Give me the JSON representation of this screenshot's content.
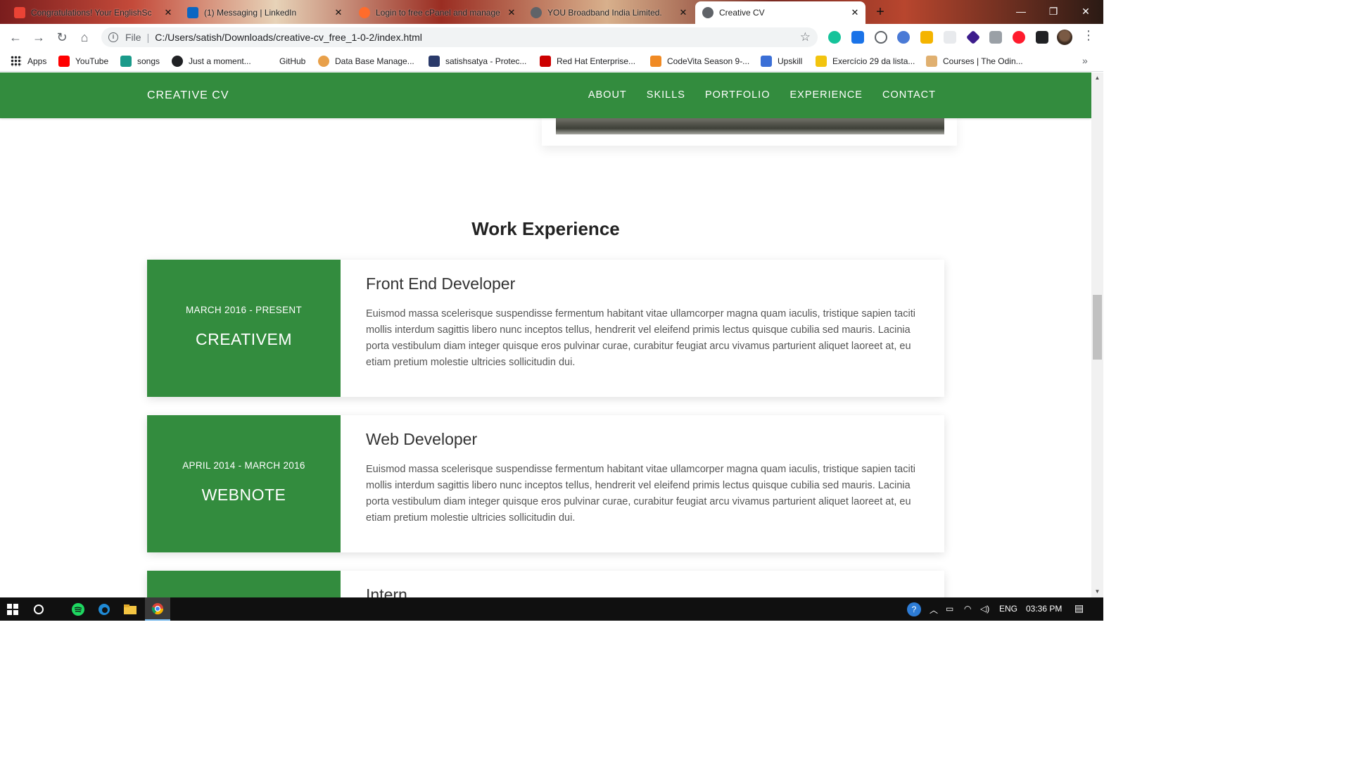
{
  "browser": {
    "tabs": [
      {
        "title": "Congratulations! Your EnglishSc",
        "favicon_color": "#ea4335"
      },
      {
        "title": "(1) Messaging | LinkedIn",
        "favicon_color": "#0a66c2"
      },
      {
        "title": "Login to free cPanel and manage",
        "favicon_color": "#ff6c2c"
      },
      {
        "title": "YOU Broadband India Limited.",
        "favicon_color": "#5f6368"
      },
      {
        "title": "Creative CV",
        "favicon_color": "#5f6368",
        "active": true
      }
    ],
    "new_tab_label": "+",
    "address": {
      "scheme": "File",
      "separator": "|",
      "url": "C:/Users/satish/Downloads/creative-cv_free_1-0-2/index.html"
    },
    "bookmarks": [
      {
        "label": "Apps",
        "icon_color": "#202124"
      },
      {
        "label": "YouTube",
        "icon_color": "#ff0000"
      },
      {
        "label": "songs",
        "icon_color": "#1a9a8a"
      },
      {
        "label": "Just a moment...",
        "icon_color": "#202124"
      },
      {
        "label": "GitHub",
        "icon_color": "#ffffff"
      },
      {
        "label": "Data Base Manage...",
        "icon_color": "#e8a04a"
      },
      {
        "label": "satishsatya - Protec...",
        "icon_color": "#2a3a6a"
      },
      {
        "label": "Red Hat Enterprise...",
        "icon_color": "#cc0000"
      },
      {
        "label": "CodeVita Season 9-...",
        "icon_color": "#f08a24"
      },
      {
        "label": "Upskill",
        "icon_color": "#3b6fd6"
      },
      {
        "label": "Exercício 29 da lista...",
        "icon_color": "#f2c40f"
      },
      {
        "label": "Courses | The Odin...",
        "icon_color": "#e0b070"
      }
    ],
    "bookmarks_overflow": "»"
  },
  "site": {
    "brand": "CREATIVE CV",
    "nav": [
      "ABOUT",
      "SKILLS",
      "PORTFOLIO",
      "EXPERIENCE",
      "CONTACT"
    ],
    "accent_color": "#338c3e",
    "section_title": "Work Experience",
    "experience": [
      {
        "date": "MARCH 2016 - PRESENT",
        "company": "CREATIVEM",
        "role": "Front End Developer",
        "description": "Euismod massa scelerisque suspendisse fermentum habitant vitae ullamcorper magna quam iaculis, tristique sapien taciti mollis interdum sagittis libero nunc inceptos tellus, hendrerit vel eleifend primis lectus quisque cubilia sed mauris. Lacinia porta vestibulum diam integer quisque eros pulvinar curae, curabitur feugiat arcu vivamus parturient aliquet laoreet at, eu etiam pretium molestie ultricies sollicitudin dui."
      },
      {
        "date": "APRIL 2014 - MARCH 2016",
        "company": "WEBNOTE",
        "role": "Web Developer",
        "description": "Euismod massa scelerisque suspendisse fermentum habitant vitae ullamcorper magna quam iaculis, tristique sapien taciti mollis interdum sagittis libero nunc inceptos tellus, hendrerit vel eleifend primis lectus quisque cubilia sed mauris. Lacinia porta vestibulum diam integer quisque eros pulvinar curae, curabitur feugiat arcu vivamus parturient aliquet laoreet at, eu etiam pretium molestie ultricies sollicitudin dui."
      },
      {
        "date": "",
        "company": "",
        "role": "Intern",
        "description": ""
      }
    ]
  },
  "taskbar": {
    "language": "ENG",
    "time": "03:36 PM"
  }
}
